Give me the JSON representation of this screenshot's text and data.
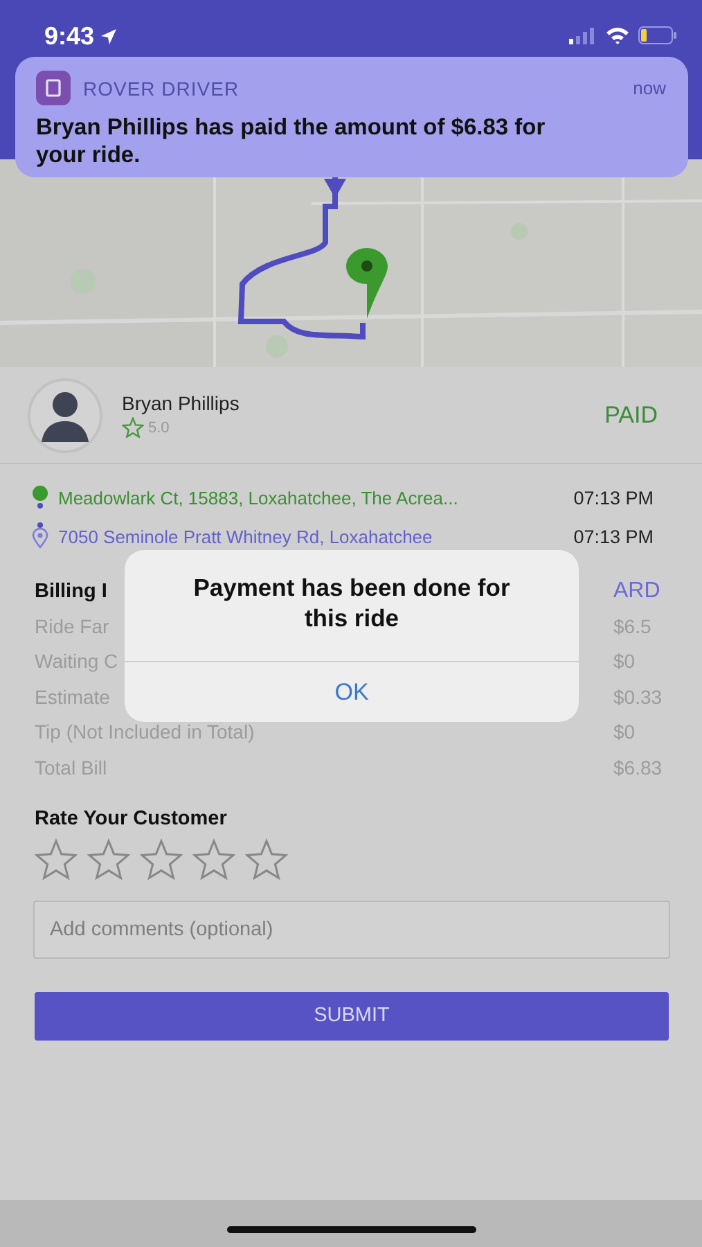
{
  "status_bar": {
    "time": "9:43"
  },
  "notification": {
    "app": "ROVER DRIVER",
    "time": "now",
    "message": "Bryan Phillips has paid the amount of $6.83 for your ride."
  },
  "customer": {
    "name": "Bryan Phillips",
    "rating": "5.0",
    "status": "PAID"
  },
  "trip": [
    {
      "kind": "pickup",
      "address": "Meadowlark Ct, 15883, Loxahatchee, The Acrea...",
      "time": "07:13 PM"
    },
    {
      "kind": "dropoff",
      "address": "7050 Seminole Pratt Whitney Rd, Loxahatchee",
      "time": "07:13 PM"
    }
  ],
  "billing": {
    "title": "Billing I",
    "payment": "ARD",
    "rows": [
      {
        "label": "Ride Far",
        "value": "$6.5"
      },
      {
        "label": "Waiting C",
        "value": "$0"
      },
      {
        "label": "Estimate",
        "value": "$0.33"
      },
      {
        "label": "Tip (Not Included in Total)",
        "value": "$0"
      },
      {
        "label": "Total Bill",
        "value": "$6.83"
      }
    ]
  },
  "rating": {
    "title": "Rate Your Customer",
    "stars": 0
  },
  "comments": {
    "placeholder": "Add comments (optional)"
  },
  "submit": "SUBMIT",
  "alert": {
    "title": "Payment has been done for this ride",
    "button": "OK"
  }
}
